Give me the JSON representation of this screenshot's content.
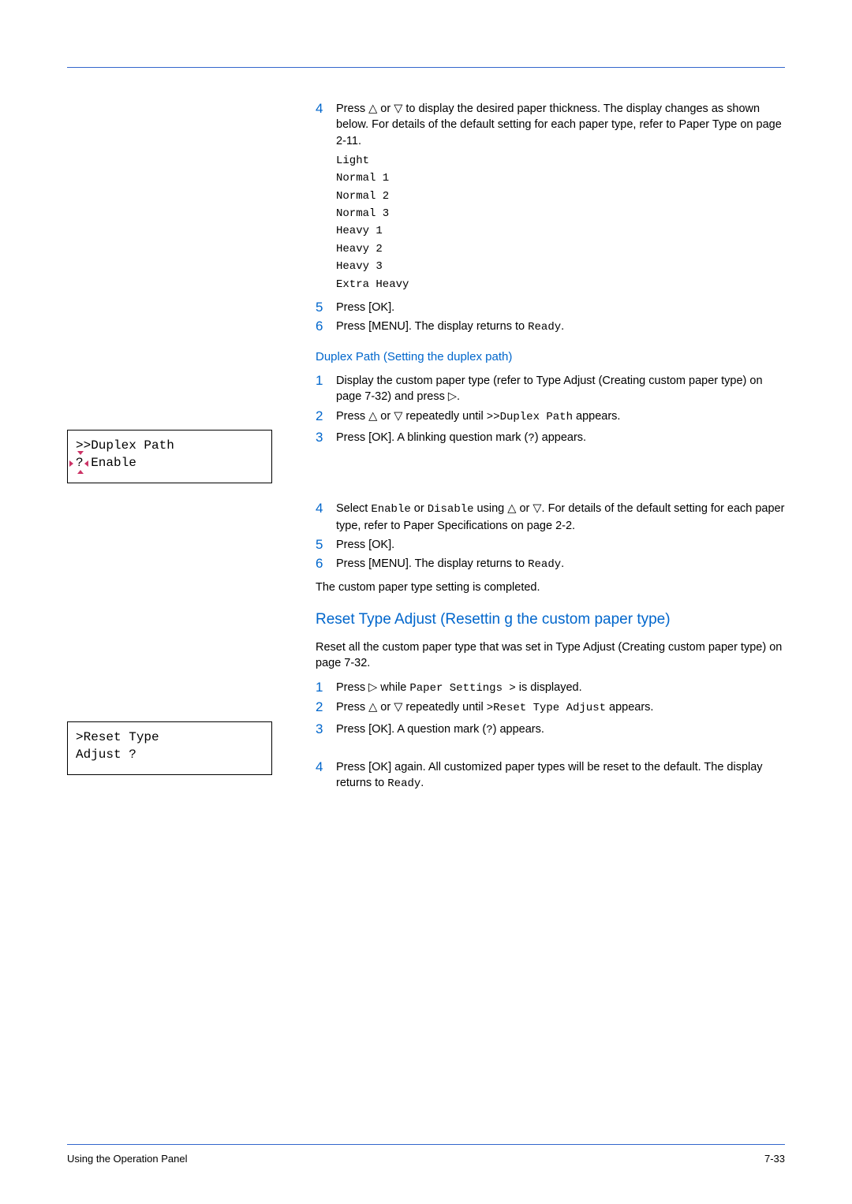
{
  "step4a": {
    "num": "4",
    "text_before": "Press ",
    "text_mid": " or ",
    "text_after": " to display the desired paper thickness. The display changes as shown below. For details of the default setting for each paper type, refer to Paper Type on page 2-11."
  },
  "thickness_options": [
    "Light",
    "Normal 1",
    "Normal 2",
    "Normal 3",
    "Heavy 1",
    "Heavy 2",
    "Heavy 3",
    "Extra Heavy"
  ],
  "step5a": {
    "num": "5",
    "text": "Press [OK]."
  },
  "step6a": {
    "num": "6",
    "text_before": "Press [MENU]. The display returns to ",
    "code": "Ready",
    "text_after": "."
  },
  "duplex_heading": "Duplex Path (Setting the duplex path)",
  "duplex_step1": {
    "num": "1",
    "text_before": "Display the custom paper type (refer to Type Adjust (Creating custom paper type) on page 7-32) and press ",
    "text_after": "."
  },
  "duplex_step2": {
    "num": "2",
    "text_before": "Press ",
    "text_mid": " or ",
    "text_mid2": " repeatedly until ",
    "code": ">>Duplex Path",
    "text_after": " appears."
  },
  "duplex_step3": {
    "num": "3",
    "text_before": "Press [OK]. A blinking question mark (",
    "code": "?",
    "text_after": ") appears."
  },
  "lcd1_line1": ">>Duplex Path",
  "lcd1_line2": "? Enable",
  "duplex_step4": {
    "num": "4",
    "text_before": "Select ",
    "code1": "Enable",
    "text_mid1": " or ",
    "code2": "Disable",
    "text_mid2": " using ",
    "text_mid3": " or ",
    "text_after": ". For details of the default setting for each paper type, refer to Paper Specifications on page 2-2."
  },
  "duplex_step5": {
    "num": "5",
    "text": "Press [OK]."
  },
  "duplex_step6": {
    "num": "6",
    "text_before": "Press [MENU]. The display returns to ",
    "code": "Ready",
    "text_after": "."
  },
  "duplex_complete": "The custom paper type setting is completed.",
  "reset_heading": "Reset Type Adjust (Resettin   g the custom paper type)",
  "reset_intro": "Reset all the custom paper type that was set in Type Adjust (Creating custom paper type) on page 7-32.",
  "reset_step1": {
    "num": "1",
    "text_before": "Press ",
    "text_mid": " while ",
    "code": "Paper Settings >",
    "text_after": " is displayed."
  },
  "reset_step2": {
    "num": "2",
    "text_before": "Press ",
    "text_mid": " or ",
    "text_mid2": " repeatedly until ",
    "code": ">Reset Type Adjust",
    "text_after": " appears."
  },
  "reset_step3": {
    "num": "3",
    "text_before": "Press [OK]. A question mark (",
    "code": "?",
    "text_after": ") appears."
  },
  "lcd2_line1": ">Reset Type",
  "lcd2_line2": "Adjust ?",
  "reset_step4": {
    "num": "4",
    "text_before": "Press [OK] again. All customized paper types will be reset to the default. The display returns to ",
    "code": "Ready",
    "text_after": "."
  },
  "footer_left": "Using the Operation Panel",
  "footer_right": "7-33"
}
